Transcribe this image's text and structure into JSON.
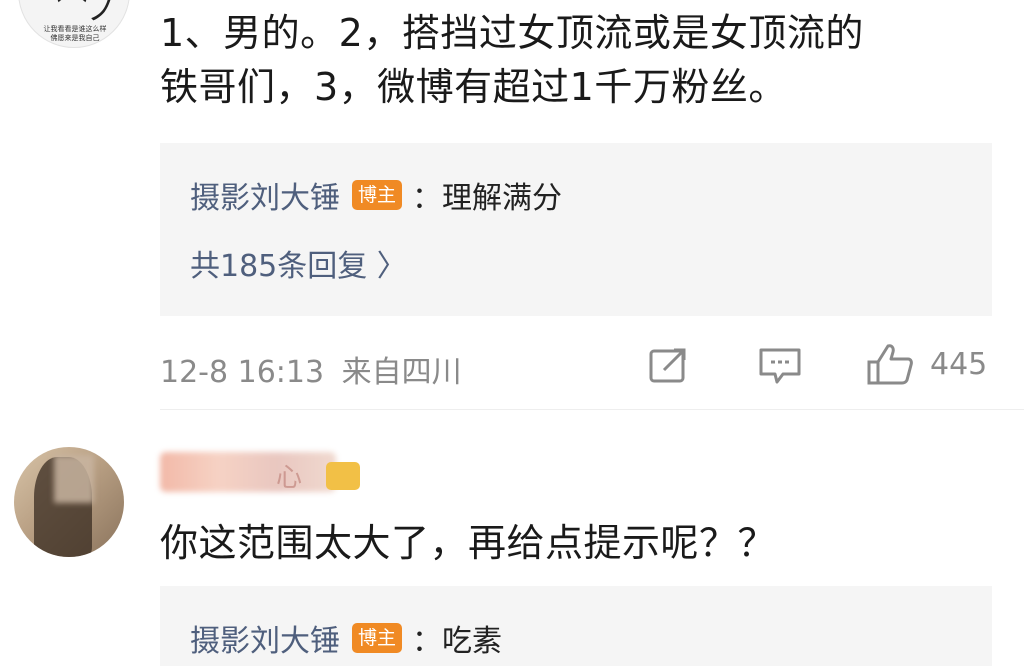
{
  "comment1": {
    "avatar_caption_1": "让我看看是谁这么样",
    "avatar_caption_2": "佛愿来是我自己",
    "text_line1": "1、男的。2，搭挡过女顶流或是女顶流的",
    "text_line2": "铁哥们，3，微博有超过1千万粉丝。",
    "reply": {
      "author": "摄影刘大锤",
      "badge": "博主",
      "content": "：理解满分",
      "more_replies": "共185条回复 〉"
    },
    "meta": {
      "time": "12-8 16:13",
      "location": "来自四川",
      "like_count": "445"
    }
  },
  "comment2": {
    "author_visible_fragment": "心",
    "text": "你这范围太大了，再给点提示呢？？",
    "reply": {
      "author": "摄影刘大锤",
      "badge": "博主",
      "content": "：吃素"
    }
  },
  "colors": {
    "link_blue": "#4f5f7d",
    "badge_orange": "#f08a24",
    "meta_gray": "#8a8a8a",
    "reply_bg": "#f5f5f5"
  },
  "icons": [
    "share-icon",
    "comment-icon",
    "like-icon"
  ]
}
